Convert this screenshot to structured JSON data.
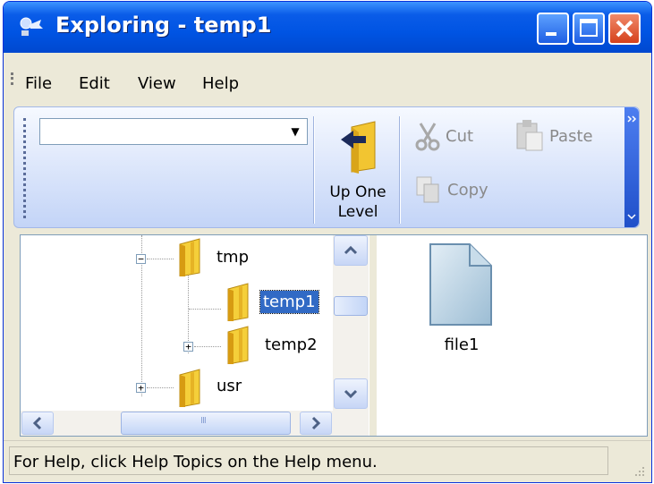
{
  "window": {
    "title": "Exploring - temp1"
  },
  "menu": {
    "items": [
      "File",
      "Edit",
      "View",
      "Help"
    ]
  },
  "toolbar": {
    "address_value": "",
    "up_level_line1": "Up One",
    "up_level_line2": "Level",
    "cut_label": "Cut",
    "paste_label": "Paste",
    "copy_label": "Copy"
  },
  "tree": {
    "nodes": [
      {
        "label": "tmp",
        "expander": "−"
      },
      {
        "label": "temp1",
        "selected": true
      },
      {
        "label": "temp2",
        "expander": "+"
      },
      {
        "label": "usr",
        "expander": "+"
      }
    ],
    "hscroll_grip": "III"
  },
  "list": {
    "items": [
      {
        "label": "file1"
      }
    ]
  },
  "status": {
    "text": "For Help, click Help Topics on the Help menu."
  },
  "colors": {
    "title_bar": "#0054e3",
    "selection": "#316ac5",
    "close_button": "#d5411c"
  },
  "icons": [
    "app-icon",
    "minimize-icon",
    "maximize-icon",
    "close-icon",
    "folder-icon",
    "up-one-level-icon",
    "cut-icon",
    "paste-icon",
    "copy-icon",
    "file-icon",
    "dropdown-arrow-icon"
  ]
}
